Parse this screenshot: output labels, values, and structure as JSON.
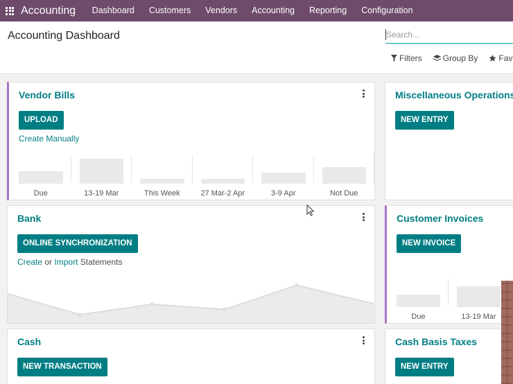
{
  "navbar": {
    "brand": "Accounting",
    "menu": [
      "Dashboard",
      "Customers",
      "Vendors",
      "Accounting",
      "Reporting",
      "Configuration"
    ]
  },
  "control_panel": {
    "title": "Accounting Dashboard",
    "search_placeholder": "Search...",
    "filters_label": "Filters",
    "group_by_label": "Group By",
    "favorites_label": "Favor"
  },
  "cards": {
    "vendor_bills": {
      "title": "Vendor Bills",
      "button": "UPLOAD",
      "link": "Create Manually",
      "chart": {
        "labels": [
          "Due",
          "13-19 Mar",
          "This Week",
          "27 Mar-2 Apr",
          "3-9 Apr",
          "Not Due"
        ],
        "values": [
          0.45,
          0.9,
          0.18,
          0.18,
          0.4,
          0.6
        ]
      }
    },
    "misc_operations": {
      "title": "Miscellaneous Operations",
      "button": "NEW ENTRY"
    },
    "bank": {
      "title": "Bank",
      "button": "ONLINE SYNCHRONIZATION",
      "link_create": "Create",
      "link_or": "or",
      "link_import": "Import",
      "link_statements": "Statements",
      "line_values": [
        0.7,
        0.1,
        0.4,
        0.25,
        0.95,
        0.4
      ]
    },
    "customer_invoices": {
      "title": "Customer Invoices",
      "button": "NEW INVOICE",
      "chart": {
        "labels": [
          "Due",
          "13-19 Mar"
        ],
        "values": [
          0.45,
          0.75
        ]
      }
    },
    "cash": {
      "title": "Cash",
      "button": "NEW TRANSACTION"
    },
    "cash_basis_taxes": {
      "title": "Cash Basis Taxes",
      "button": "NEW ENTRY"
    }
  },
  "colors": {
    "navbar": "#6e4b6a",
    "accent_teal": "#017e84",
    "card_accent": "#a772c5"
  },
  "icons": [
    "apps-grid-icon",
    "filter-icon",
    "layers-icon",
    "star-icon",
    "kebab-icon",
    "mouse-cursor-icon"
  ]
}
